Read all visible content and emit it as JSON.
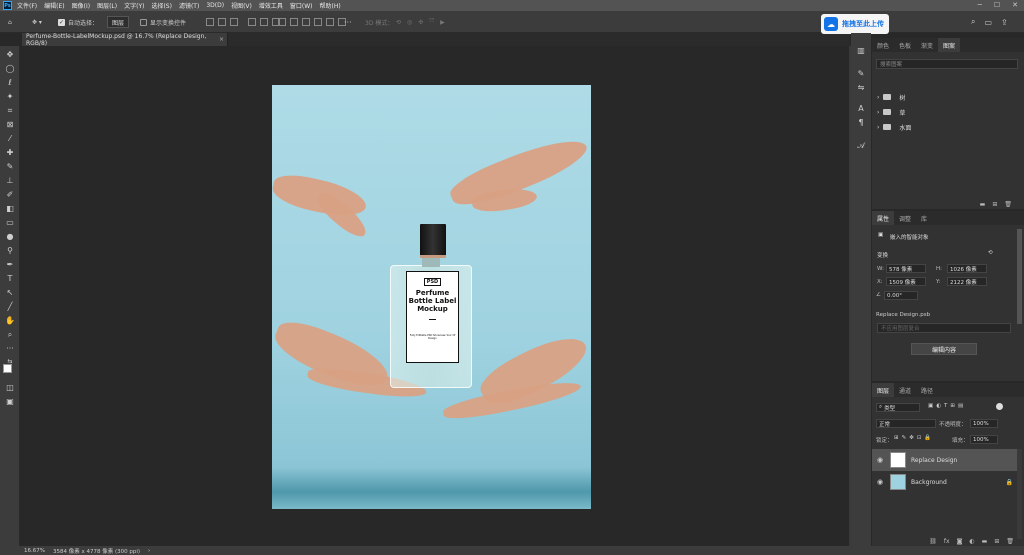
{
  "app": {
    "badge": "Ps"
  },
  "menu": [
    "文件(F)",
    "编辑(E)",
    "图像(I)",
    "图层(L)",
    "文字(Y)",
    "选择(S)",
    "滤镜(T)",
    "3D(D)",
    "视图(V)",
    "增效工具",
    "窗口(W)",
    "帮助(H)"
  ],
  "options": {
    "auto_select_label": "自动选择：",
    "auto_select_value": "图层",
    "transform_label": "显示变换控件",
    "more": "···",
    "mode_3d": "3D 模式："
  },
  "cloud_button": "拖拽至此上传",
  "document_tab": "Perfume-Bottle-LabelMockup.psd @ 16.7% (Replace Design, RGB/8)",
  "label_art": {
    "badge": "PSD",
    "title": "Perfume Bottle Label Mockup",
    "small": "Fully Editable PSD Showcase Your Of Design"
  },
  "panel_top": {
    "tabs": [
      "颜色",
      "色板",
      "渐变",
      "图案"
    ],
    "search_placeholder": "搜索图案",
    "groups": [
      "树",
      "草",
      "水面"
    ]
  },
  "properties": {
    "tabs": [
      "属性",
      "调整",
      "库"
    ],
    "kind": "嵌入的智能对象",
    "section": "变换",
    "w_label": "W:",
    "w_value": "578 像素",
    "h_label": "H:",
    "h_value": "1026 像素",
    "x_label": "X:",
    "x_value": "1509 像素",
    "y_label": "Y:",
    "y_value": "2122 像素",
    "angle": "0.00°",
    "file": "Replace Design.psb",
    "placeholder_comp": "不应用图层复合",
    "edit_button": "编辑内容"
  },
  "layers": {
    "tabs": [
      "图层",
      "通道",
      "路径"
    ],
    "filter": "类型",
    "blend": "正常",
    "opacity_label": "不透明度：",
    "opacity": "100%",
    "lock_label": "锁定：",
    "fill_label": "填充：",
    "fill": "100%",
    "items": [
      {
        "name": "Replace Design"
      },
      {
        "name": "Background"
      }
    ]
  },
  "status": {
    "zoom": "16.67%",
    "info": "3584 像素 x 4778 像素 (300 ppi)",
    "arrow": "›"
  }
}
